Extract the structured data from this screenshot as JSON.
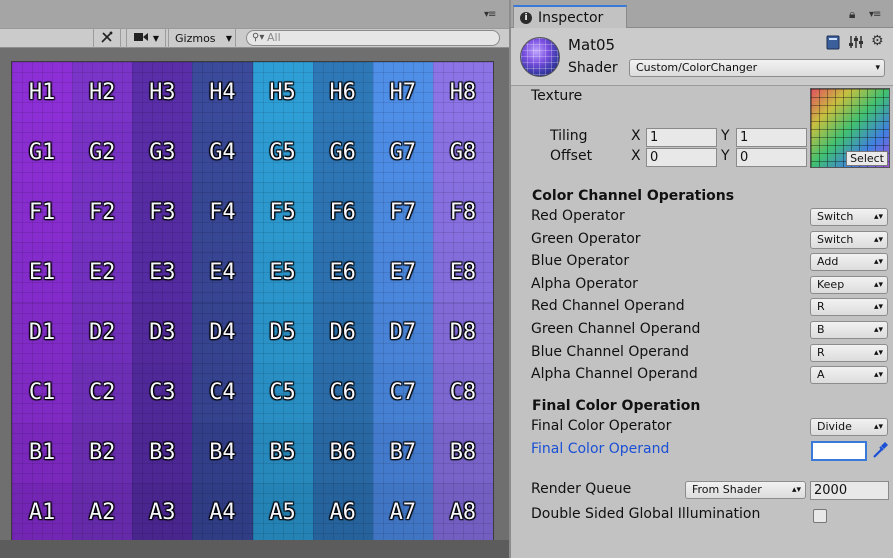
{
  "scene": {
    "toolbar": {
      "tools_icon": "tools-icon",
      "camera_icon": "video-camera-icon",
      "gizmos_label": "Gizmos",
      "search_placeholder": "All"
    },
    "grid": {
      "rows": [
        [
          "H1",
          "H2",
          "H3",
          "H4",
          "H5",
          "H6",
          "H7",
          "H8"
        ],
        [
          "G1",
          "G2",
          "G3",
          "G4",
          "G5",
          "G6",
          "G7",
          "G8"
        ],
        [
          "F1",
          "F2",
          "F3",
          "F4",
          "F5",
          "F6",
          "F7",
          "F8"
        ],
        [
          "E1",
          "E2",
          "E3",
          "E4",
          "E5",
          "E6",
          "E7",
          "E8"
        ],
        [
          "D1",
          "D2",
          "D3",
          "D4",
          "D5",
          "D6",
          "D7",
          "D8"
        ],
        [
          "C1",
          "C2",
          "C3",
          "C4",
          "C5",
          "C6",
          "C7",
          "C8"
        ],
        [
          "B1",
          "B2",
          "B3",
          "B4",
          "B5",
          "B6",
          "B7",
          "B8"
        ],
        [
          "A1",
          "A2",
          "A3",
          "A4",
          "A5",
          "A6",
          "A7",
          "A8"
        ]
      ],
      "column_colors": [
        "#8d2fd6",
        "#7a34c8",
        "#5a2ea8",
        "#3b4a9a",
        "#2e9fd6",
        "#2f78b8",
        "#4f8fe8",
        "#8c74e6"
      ],
      "row_shade": [
        0.0,
        0.02,
        0.04,
        0.06,
        0.08,
        0.1,
        0.14,
        0.18
      ]
    }
  },
  "inspector": {
    "tab_label": "Inspector",
    "material_name": "Mat05",
    "shader_label": "Shader",
    "shader_value": "Custom/ColorChanger",
    "texture_label": "Texture",
    "tiling_label": "Tiling",
    "offset_label": "Offset",
    "x_label": "X",
    "y_label": "Y",
    "tiling_x": "1",
    "tiling_y": "1",
    "offset_x": "0",
    "offset_y": "0",
    "texture_select": "Select",
    "color_channel_title": "Color Channel Operations",
    "operations": [
      {
        "label": "Red Operator",
        "value": "Switch"
      },
      {
        "label": "Green Operator",
        "value": "Switch"
      },
      {
        "label": "Blue Operator",
        "value": "Add"
      },
      {
        "label": "Alpha Operator",
        "value": "Keep"
      },
      {
        "label": "Red Channel Operand",
        "value": "R"
      },
      {
        "label": "Green Channel Operand",
        "value": "B"
      },
      {
        "label": "Blue Channel Operand",
        "value": "R"
      },
      {
        "label": "Alpha Channel Operand",
        "value": "A"
      }
    ],
    "final_title": "Final Color Operation",
    "final_operator_label": "Final Color Operator",
    "final_operator_value": "Divide",
    "final_operand_label": "Final Color Operand",
    "final_operand_color": "#ffffff",
    "render_queue_label": "Render Queue",
    "render_queue_mode": "From Shader",
    "render_queue_value": "2000",
    "double_sided_label": "Double Sided Global Illumination",
    "double_sided_checked": false,
    "accent_color": "#3a79d7",
    "link_color": "#1a4fd6"
  }
}
